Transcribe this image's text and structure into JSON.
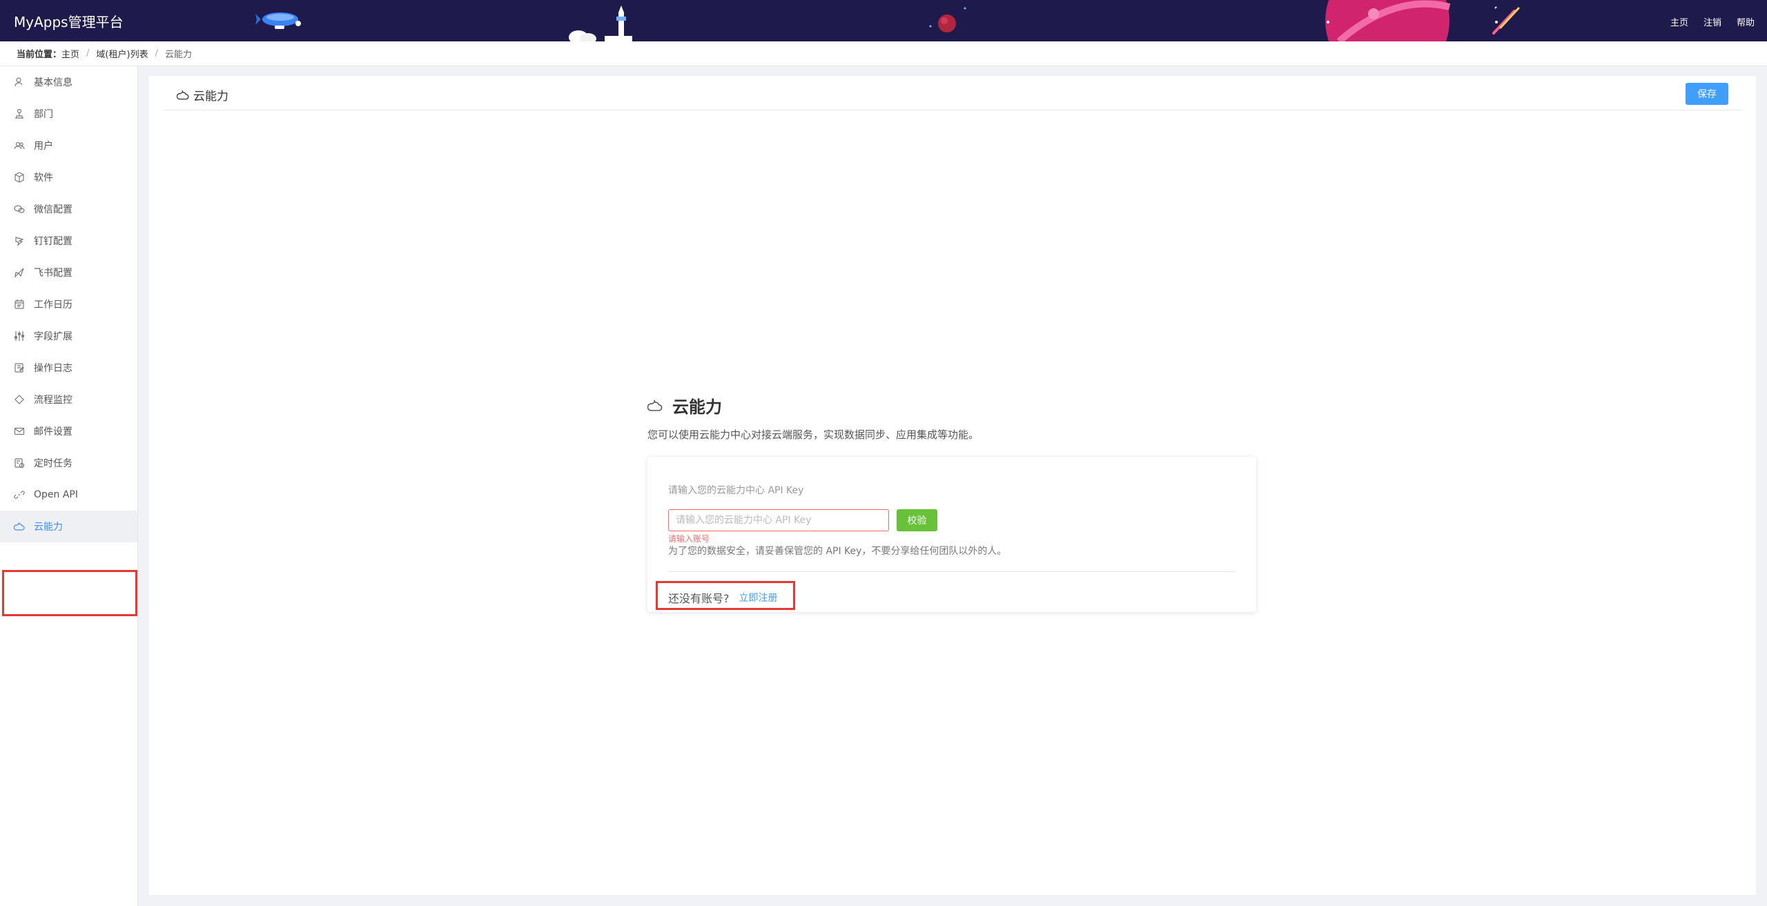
{
  "header": {
    "brand": "MyApps管理平台",
    "nav": [
      "主页",
      "注销",
      "帮助"
    ]
  },
  "breadcrumb": {
    "lead": "当前位置：",
    "items": [
      "主页",
      "域(租户)列表",
      "云能力"
    ]
  },
  "sidebar": {
    "items": [
      {
        "label": "基本信息",
        "icon": "user-icon"
      },
      {
        "label": "部门",
        "icon": "org-icon"
      },
      {
        "label": "用户",
        "icon": "users-icon"
      },
      {
        "label": "软件",
        "icon": "box-icon"
      },
      {
        "label": "微信配置",
        "icon": "wechat-icon"
      },
      {
        "label": "钉钉配置",
        "icon": "dingtalk-icon"
      },
      {
        "label": "飞书配置",
        "icon": "feishu-icon"
      },
      {
        "label": "工作日历",
        "icon": "calendar-icon"
      },
      {
        "label": "字段扩展",
        "icon": "sliders-icon"
      },
      {
        "label": "操作日志",
        "icon": "log-icon"
      },
      {
        "label": "流程监控",
        "icon": "diamond-icon"
      },
      {
        "label": "邮件设置",
        "icon": "mail-icon"
      },
      {
        "label": "定时任务",
        "icon": "clock-doc-icon"
      },
      {
        "label": "Open API",
        "icon": "link-icon"
      },
      {
        "label": "云能力",
        "icon": "cloud-icon"
      }
    ],
    "active_index": 14
  },
  "panel": {
    "title": "云能力",
    "save_label": "保存"
  },
  "cloud": {
    "title": "云能力",
    "description": "您可以使用云能力中心对接云端服务，实现数据同步、应用集成等功能。",
    "input_label": "请输入您的云能力中心 API Key",
    "input_placeholder": "请输入您的云能力中心 API Key",
    "check_label": "校验",
    "error": "请输入账号",
    "note": "为了您的数据安全，请妥善保管您的 API Key，不要分享给任何团队以外的人。",
    "no_account": "还没有账号?",
    "register_link": "立即注册"
  },
  "colors": {
    "header_bg": "#1f1a4c",
    "primary": "#409eff",
    "success": "#67c23a",
    "error": "#f56c6c",
    "highlight": "#e53935"
  }
}
